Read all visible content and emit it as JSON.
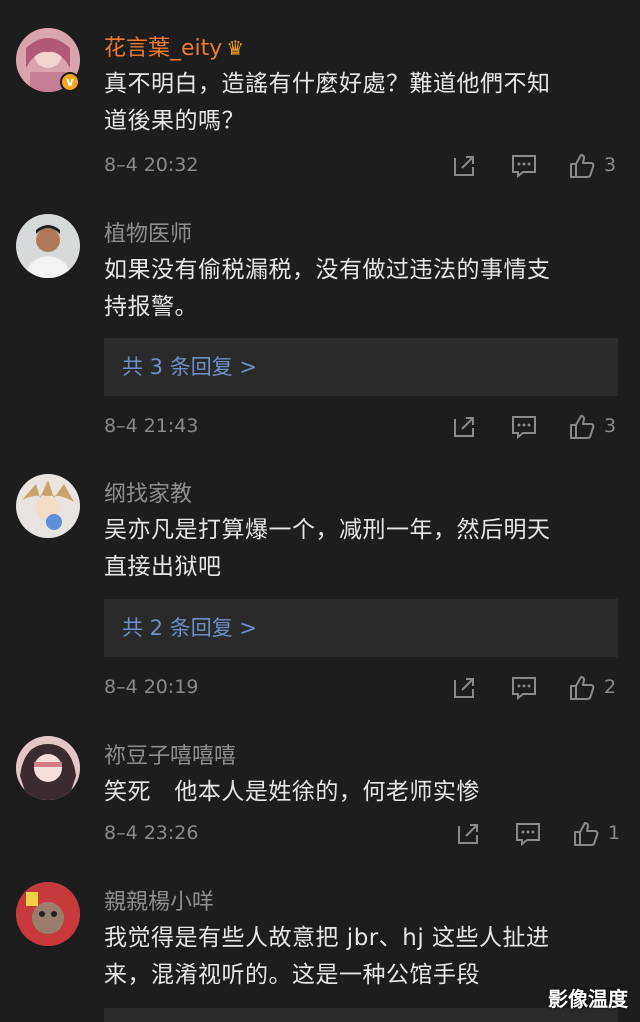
{
  "comments": [
    {
      "username": "花言葉_eity",
      "text_lines": [
        "真不明白，造謠有什麼好處？難道他們不知",
        "道後果的嗎？"
      ],
      "time": "8–4 20:32",
      "likes": "3",
      "verified": true
    },
    {
      "username": "植物医师",
      "text_lines": [
        "如果没有偷税漏税，没有做过违法的事情支",
        "持报警。"
      ],
      "replies_label": "共 3 条回复 >",
      "time": "8–4 21:43",
      "likes": "3"
    },
    {
      "username": "纲找家教",
      "text_lines": [
        "吴亦凡是打算爆一个，减刑一年，然后明天",
        "直接出狱吧"
      ],
      "replies_label": "共 2 条回复 >",
      "time": "8–4 20:19",
      "likes": "2"
    },
    {
      "username": "祢豆子嘻嘻嘻",
      "text_lines": [
        "笑死   他本人是姓徐的，何老师实惨"
      ],
      "time": "8–4 23:26",
      "likes": "1"
    },
    {
      "username": "親親楊小咩",
      "text_lines": [
        "我觉得是有些人故意把 jbr、hj 这些人扯进",
        "来，混淆视听的。这是一种公馆手段"
      ]
    }
  ],
  "watermark": "影像温度",
  "colors": {
    "background": "#1d1d1d",
    "vip_name": "#f07a2e",
    "reply_link": "#6d8fc7"
  }
}
